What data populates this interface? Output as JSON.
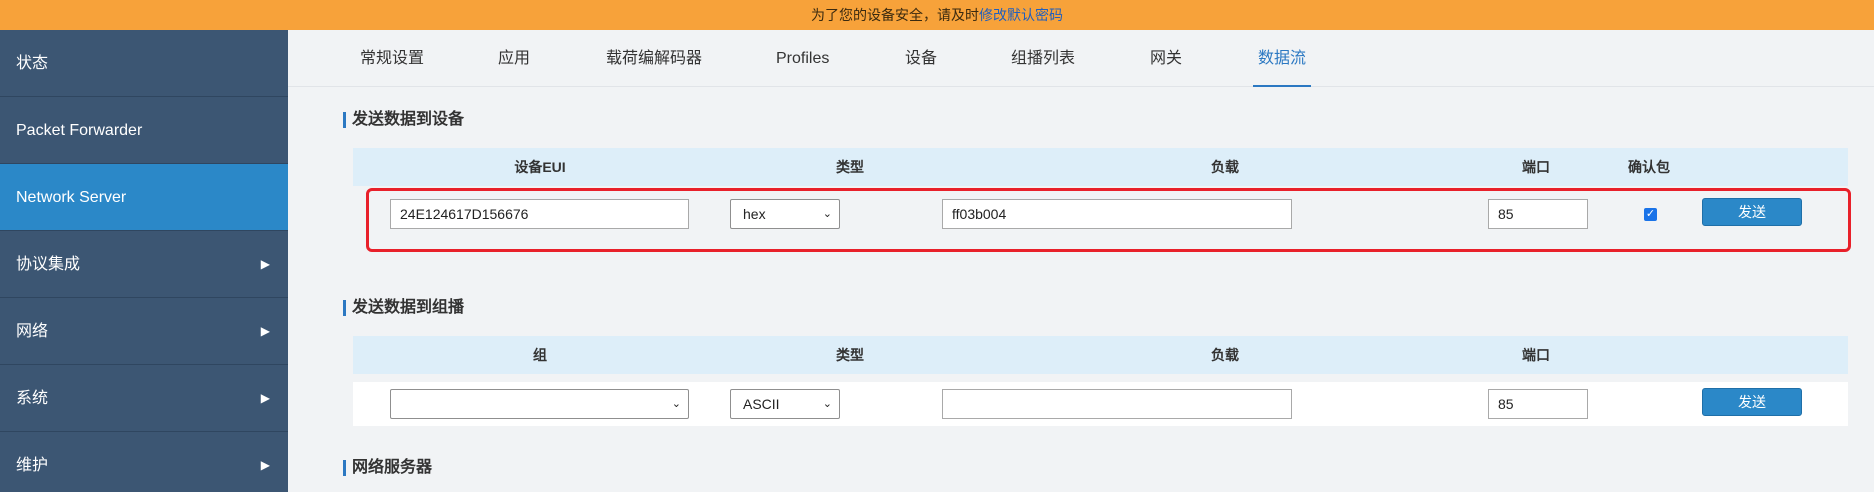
{
  "banner": {
    "text": "为了您的设备安全，请及时",
    "link": "修改默认密码"
  },
  "sidebar": {
    "items": [
      {
        "label": "状态",
        "has_arrow": false
      },
      {
        "label": "Packet Forwarder",
        "has_arrow": false
      },
      {
        "label": "Network Server",
        "has_arrow": false,
        "active": true
      },
      {
        "label": "协议集成",
        "has_arrow": true
      },
      {
        "label": "网络",
        "has_arrow": true
      },
      {
        "label": "系统",
        "has_arrow": true
      },
      {
        "label": "维护",
        "has_arrow": true
      }
    ],
    "arrow_icon": "caret-right-icon"
  },
  "tabs": [
    "常规设置",
    "应用",
    "载荷编解码器",
    "Profiles",
    "设备",
    "组播列表",
    "网关",
    "数据流"
  ],
  "active_tab": "数据流",
  "send_device": {
    "title": "发送数据到设备",
    "headers": {
      "eui": "设备EUI",
      "type": "类型",
      "payload": "负载",
      "port": "端口",
      "confirm": "确认包"
    },
    "eui": "24E124617D156676",
    "type": "hex",
    "payload": "ff03b004",
    "port": "85",
    "confirmed": true,
    "send_label": "发送"
  },
  "send_multicast": {
    "title": "发送数据到组播",
    "headers": {
      "group": "组",
      "type": "类型",
      "payload": "负载",
      "port": "端口"
    },
    "group": "",
    "type": "ASCII",
    "payload": "",
    "port": "85",
    "send_label": "发送"
  },
  "network_server_title": "网络服务器",
  "colors": {
    "accent": "#2b88c8",
    "sidebar": "#3c5673",
    "banner": "#f7a23a",
    "highlight": "#e8202a"
  }
}
